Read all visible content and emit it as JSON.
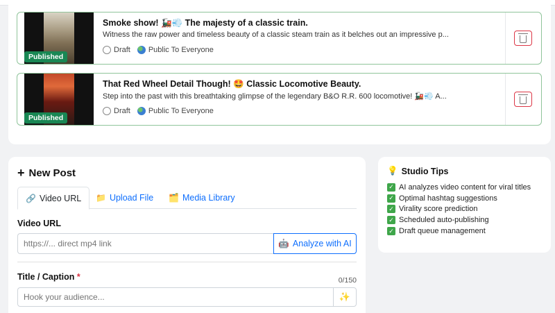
{
  "posts": [
    {
      "status_badge": "Published",
      "title": "Smoke show! 🚂💨 The majesty of a classic train.",
      "description": "Witness the raw power and timeless beauty of a classic steam train as it belches out an impressive p...",
      "draft_label": "Draft",
      "visibility_label": "Public To Everyone"
    },
    {
      "status_badge": "Published",
      "title": "That Red Wheel Detail Though! 🤩 Classic Locomotive Beauty.",
      "description": "Step into the past with this breathtaking glimpse of the legendary B&O R.R. 600 locomotive! 🚂💨 A...",
      "draft_label": "Draft",
      "visibility_label": "Public To Everyone"
    }
  ],
  "new_post": {
    "heading": "New Post",
    "tabs": [
      {
        "label": "Video URL",
        "icon": "🔗"
      },
      {
        "label": "Upload File",
        "icon": "📁"
      },
      {
        "label": "Media Library",
        "icon": "🗂️"
      }
    ],
    "video_url_label": "Video URL",
    "video_url_placeholder": "https://... direct mp4 link",
    "analyze_label": "Analyze with AI",
    "analyze_icon": "🤖",
    "title_label": "Title / Caption",
    "required_mark": "*",
    "char_counter": "0/150",
    "title_placeholder": "Hook your audience...",
    "sparkle_icon": "✨"
  },
  "tips": {
    "icon": "💡",
    "heading": "Studio Tips",
    "items": [
      "AI analyzes video content for viral titles",
      "Optimal hashtag suggestions",
      "Virality score prediction",
      "Scheduled auto-publishing",
      "Draft queue management"
    ]
  },
  "colors": {
    "primary": "#0d6efd",
    "success": "#198754",
    "danger": "#dc3545",
    "background": "#f1f2f4"
  }
}
